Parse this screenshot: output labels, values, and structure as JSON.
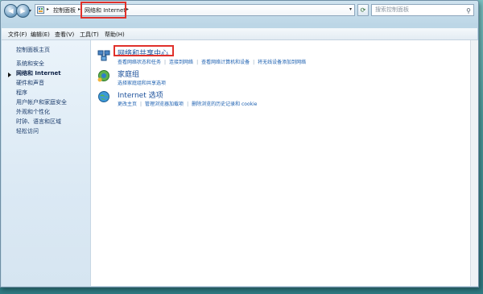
{
  "address": {
    "root": "控制面板",
    "current": "网络和 Internet",
    "search_placeholder": "搜索控制面板"
  },
  "menu": [
    "文件(F)",
    "编辑(E)",
    "查看(V)",
    "工具(T)",
    "帮助(H)"
  ],
  "sidebar": {
    "items": [
      {
        "label": "控制面板主页"
      },
      {
        "label": "系统和安全"
      },
      {
        "label": "网络和 Internet"
      },
      {
        "label": "硬件和声音"
      },
      {
        "label": "程序"
      },
      {
        "label": "用户帐户和家庭安全"
      },
      {
        "label": "外观和个性化"
      },
      {
        "label": "时钟、语言和区域"
      },
      {
        "label": "轻松访问"
      }
    ]
  },
  "categories": [
    {
      "title": "网络和共享中心",
      "links": [
        "查看网络状态和任务",
        "连接到网络",
        "查看网络计算机和设备",
        "将无线设备添加到网络"
      ]
    },
    {
      "title": "家庭组",
      "links": [
        "选择家庭组和共享选项"
      ]
    },
    {
      "title": "Internet 选项",
      "links": [
        "更改主页",
        "管理浏览器加载项",
        "删除浏览的历史记录和 cookie"
      ]
    }
  ],
  "colors": {
    "highlight": "#e0312b",
    "link": "#1b5fb0"
  }
}
